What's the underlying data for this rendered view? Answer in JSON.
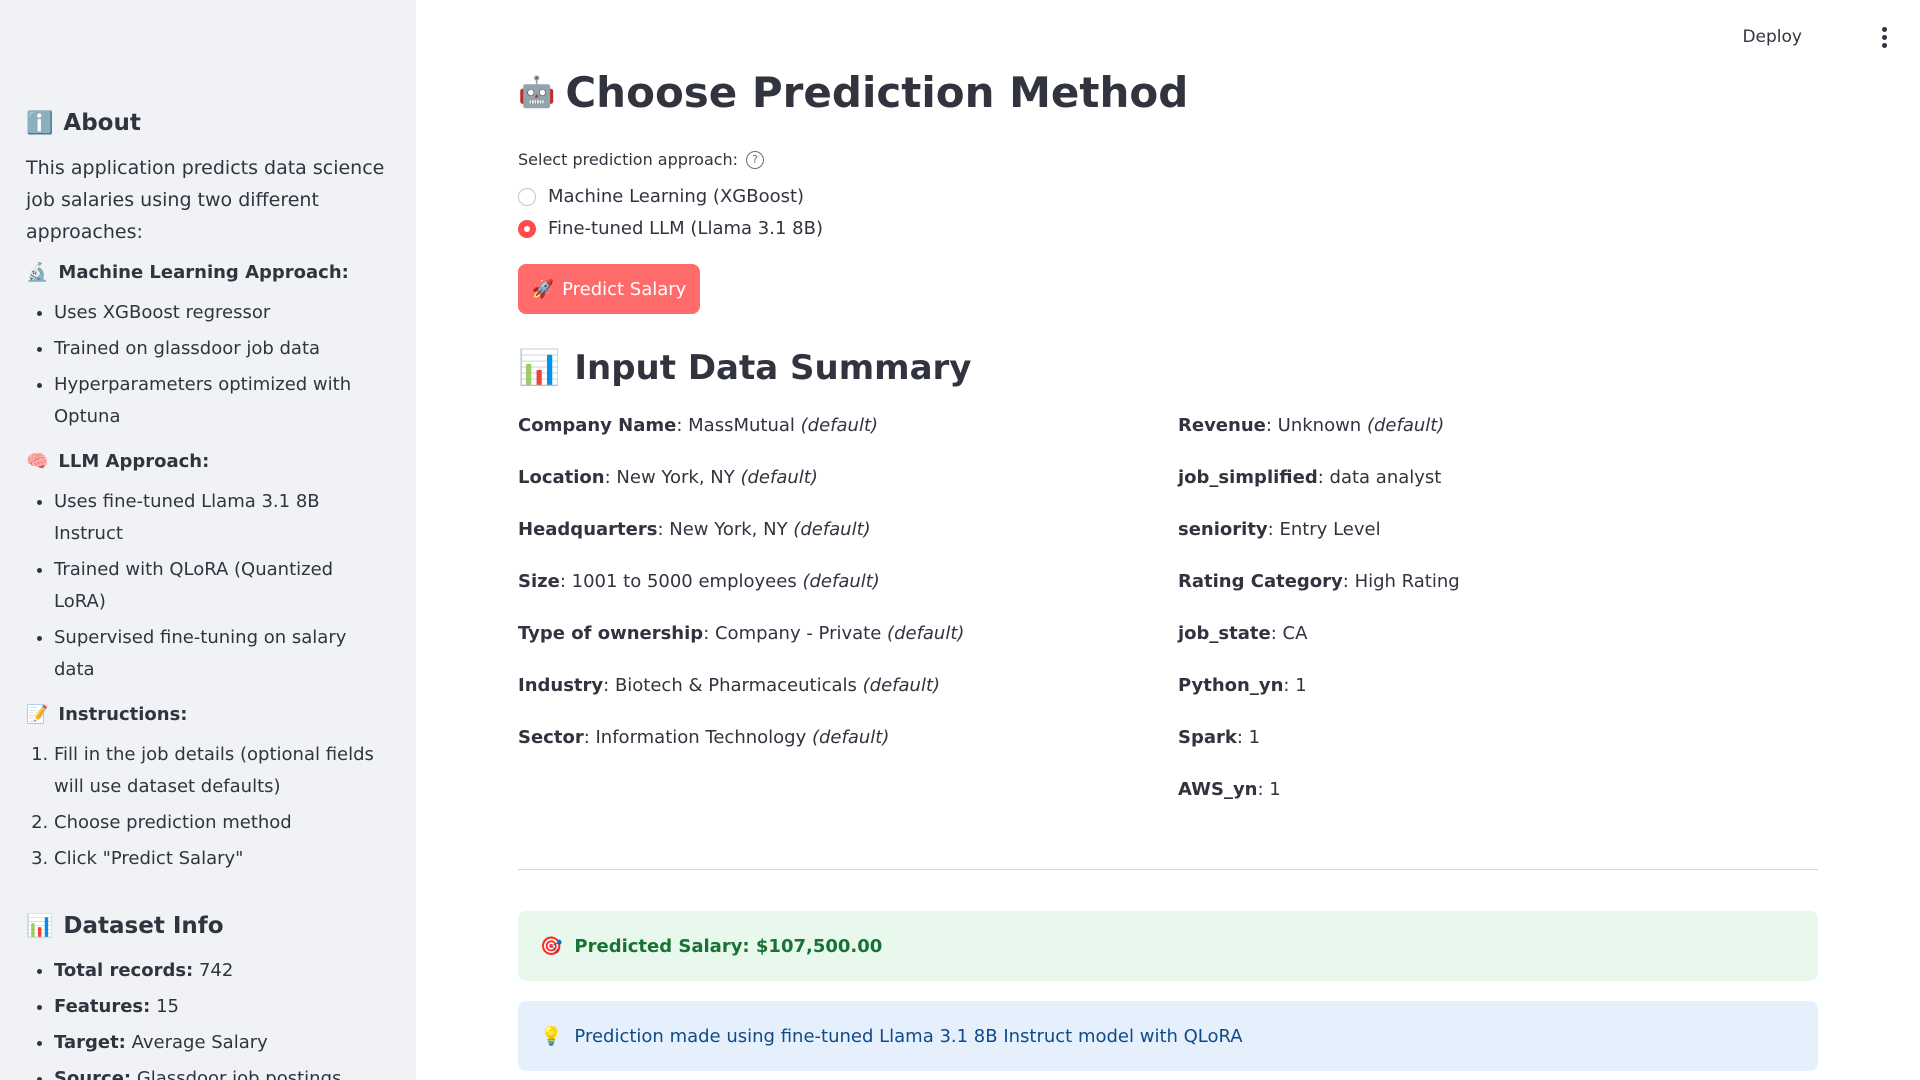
{
  "topbar": {
    "deploy_label": "Deploy"
  },
  "sidebar": {
    "about": {
      "icon": "ℹ️",
      "title": "About",
      "description": "This application predicts data science job salaries using two different approaches:"
    },
    "ml_approach": {
      "icon": "🔬",
      "title": "Machine Learning Approach:",
      "items": [
        "Uses XGBoost regressor",
        "Trained on glassdoor job data",
        "Hyperparameters optimized with Optuna"
      ]
    },
    "llm_approach": {
      "icon": "🧠",
      "title": "LLM Approach:",
      "items": [
        "Uses fine-tuned Llama 3.1 8B Instruct",
        "Trained with QLoRA (Quantized LoRA)",
        "Supervised fine-tuning on salary data"
      ]
    },
    "instructions": {
      "icon": "📝",
      "title": "Instructions:",
      "items": [
        "Fill in the job details (optional fields will use dataset defaults)",
        "Choose prediction method",
        "Click \"Predict Salary\""
      ]
    },
    "dataset": {
      "icon": "📊",
      "title": "Dataset Info",
      "items": [
        {
          "label": "Total records:",
          "value": " 742"
        },
        {
          "label": "Features:",
          "value": " 15"
        },
        {
          "label": "Target:",
          "value": " Average Salary"
        },
        {
          "label": "Source:",
          "value": " Glassdoor job postings"
        }
      ]
    }
  },
  "main": {
    "title_icon": "🤖",
    "title": "Choose Prediction Method",
    "radio_label": "Select prediction approach:",
    "help_glyph": "?",
    "options": [
      {
        "label": "Machine Learning (XGBoost)",
        "checked": false
      },
      {
        "label": "Fine-tuned LLM (Llama 3.1 8B)",
        "checked": true
      }
    ],
    "predict_icon": "🚀",
    "predict_label": "Predict Salary",
    "summary_icon": "📊",
    "summary_title": "Input Data Summary",
    "default_tag": "(default)",
    "left_fields": [
      {
        "label": "Company Name",
        "value": "MassMutual",
        "default": true
      },
      {
        "label": "Location",
        "value": "New York, NY",
        "default": true
      },
      {
        "label": "Headquarters",
        "value": "New York, NY",
        "default": true
      },
      {
        "label": "Size",
        "value": "1001 to 5000 employees",
        "default": true
      },
      {
        "label": "Type of ownership",
        "value": "Company - Private",
        "default": true
      },
      {
        "label": "Industry",
        "value": "Biotech & Pharmaceuticals",
        "default": true
      },
      {
        "label": "Sector",
        "value": "Information Technology",
        "default": true
      }
    ],
    "right_fields": [
      {
        "label": "Revenue",
        "value": "Unknown",
        "default": true
      },
      {
        "label": "job_simplified",
        "value": "data analyst",
        "default": false
      },
      {
        "label": "seniority",
        "value": "Entry Level",
        "default": false
      },
      {
        "label": "Rating Category",
        "value": "High Rating",
        "default": false
      },
      {
        "label": "job_state",
        "value": "CA",
        "default": false
      },
      {
        "label": "Python_yn",
        "value": "1",
        "default": false
      },
      {
        "label": "Spark",
        "value": "1",
        "default": false
      },
      {
        "label": "AWS_yn",
        "value": "1",
        "default": false
      }
    ],
    "success_icon": "🎯",
    "success_text": "Predicted Salary: $107,500.00",
    "info_icon": "💡",
    "info_text": "Prediction made using fine-tuned Llama 3.1 8B Instruct model with QLoRA"
  }
}
